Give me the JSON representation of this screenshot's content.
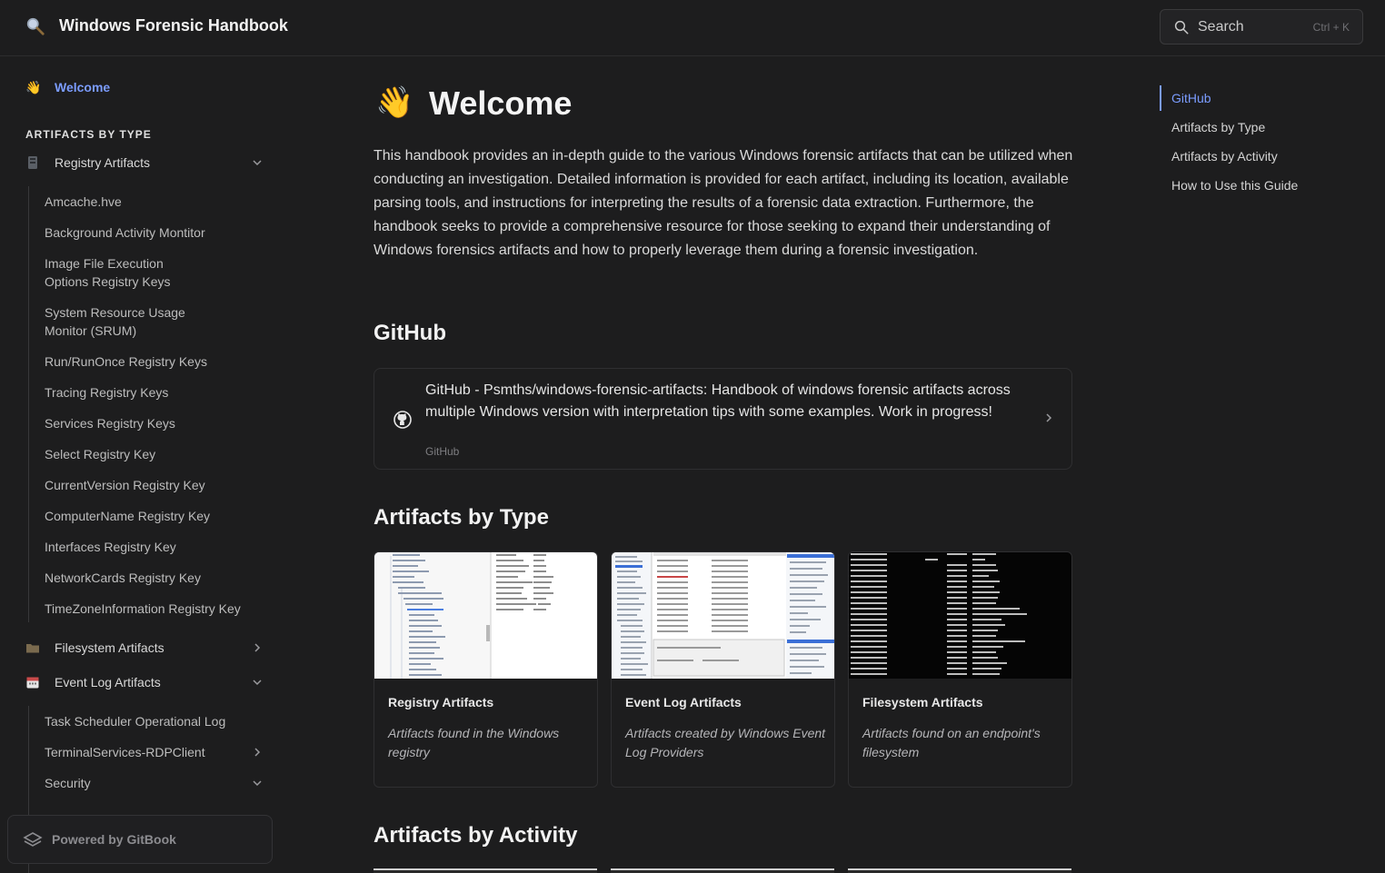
{
  "header": {
    "site_title": "Windows Forensic Handbook",
    "search_label": "Search",
    "search_shortcut": "Ctrl + K"
  },
  "sidebar": {
    "welcome": {
      "emoji": "👋",
      "label": "Welcome"
    },
    "section_title": "ARTIFACTS BY TYPE",
    "groups": [
      {
        "icon": "registry-icon",
        "label": "Registry Artifacts",
        "expanded": true,
        "items": [
          "Amcache.hve",
          "Background Activity Montitor",
          "Image File Execution Options Registry Keys",
          "System Resource Usage Monitor (SRUM)",
          "Run/RunOnce Registry Keys",
          "Tracing Registry Keys",
          "Services Registry Keys",
          "Select Registry Key",
          "CurrentVersion Registry Key",
          "ComputerName Registry Key",
          "Interfaces Registry Key",
          "NetworkCards Registry Key",
          "TimeZoneInformation Registry Key"
        ]
      },
      {
        "icon": "folder-icon",
        "label": "Filesystem Artifacts",
        "expanded": false
      },
      {
        "icon": "calendar-icon",
        "label": "Event Log Artifacts",
        "expanded": true,
        "items": [
          "Task Scheduler Operational Log",
          "TerminalServices-RDPClient",
          "Security"
        ]
      }
    ],
    "powered_by": "Powered by GitBook"
  },
  "main": {
    "emoji": "👋",
    "title": "Welcome",
    "intro": "This handbook provides an in-depth guide to the various Windows forensic artifacts that can be utilized when conducting an investigation. Detailed information is provided for each artifact, including its location, available parsing tools, and instructions for interpreting the results of a forensic data extraction. Furthermore, the handbook seeks to provide a comprehensive resource for those seeking to expand their understanding of Windows forensics artifacts and how to properly leverage them during a forensic investigation.",
    "github_heading": "GitHub",
    "github_card": {
      "title": "GitHub - Psmths/windows-forensic-artifacts: Handbook of windows forensic artifacts across multiple Windows version with interpretation tips with some examples. Work in progress!",
      "source": "GitHub"
    },
    "type_heading": "Artifacts by Type",
    "type_cards": [
      {
        "title": "Registry Artifacts",
        "description": "Artifacts found in the Windows registry"
      },
      {
        "title": "Event Log Artifacts",
        "description": "Artifacts created by Windows Event Log Providers"
      },
      {
        "title": "Filesystem Artifacts",
        "description": "Artifacts found on an endpoint's filesystem"
      }
    ],
    "activity_heading": "Artifacts by Activity"
  },
  "toc": {
    "items": [
      "GitHub",
      "Artifacts by Type",
      "Artifacts by Activity",
      "How to Use this Guide"
    ],
    "active_index": 0
  },
  "colors": {
    "accent": "#7b9cff",
    "background": "#1d1d1e"
  }
}
